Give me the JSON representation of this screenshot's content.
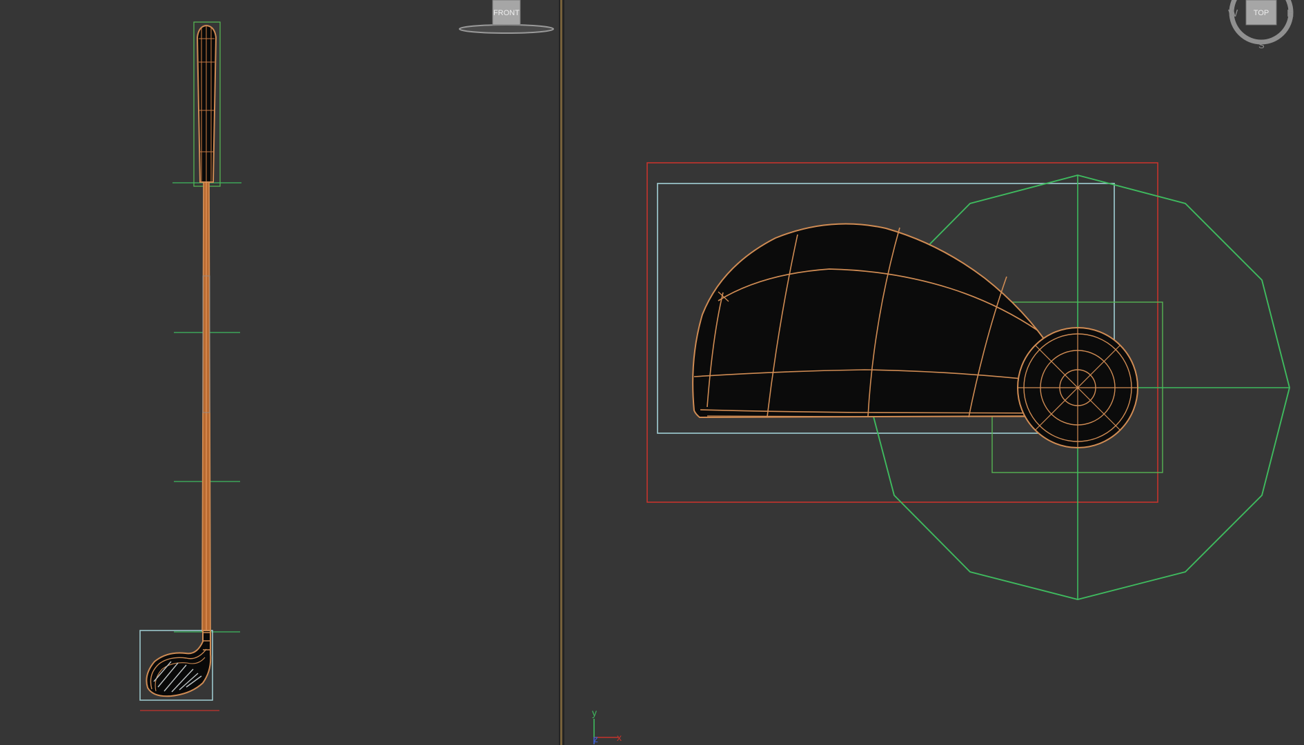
{
  "viewports": {
    "front": {
      "viewcube_label": "FRONT"
    },
    "top": {
      "viewcube_label": "TOP",
      "compass": {
        "west": "W",
        "east": "E",
        "south": "S"
      },
      "axis_labels": {
        "y": "y",
        "z": "z",
        "x": "x"
      }
    }
  },
  "colors": {
    "viewport_bg": "#363636",
    "divider": "#77613a",
    "wire_orange": "#d08c54",
    "mesh_fill": "#0c0c0c",
    "helper_green": "#3fbb5f",
    "bbox_red": "#c6342c",
    "bbox_cyan": "#9cc7cc",
    "viewcube_gray": "#9a9a9a"
  },
  "icons": {
    "front_viewcube": "viewcube-front-icon",
    "top_viewcube": "viewcube-top-icon",
    "axis_tripod": "axis-tripod-icon"
  }
}
